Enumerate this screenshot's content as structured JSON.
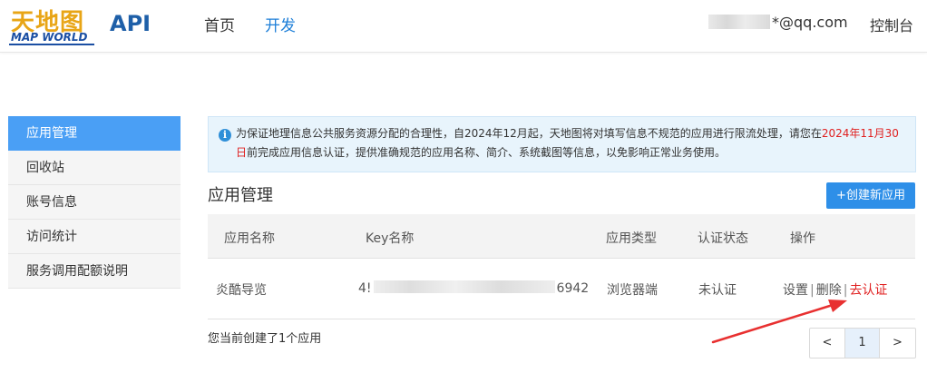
{
  "header": {
    "logo_cn": "天地图",
    "logo_en": "MAP WORLD",
    "api_label": "API",
    "nav": [
      {
        "label": "首页",
        "active": false
      },
      {
        "label": "开发",
        "active": true
      }
    ],
    "email_suffix": "*@qq.com",
    "console_label": "控制台"
  },
  "sidebar": {
    "items": [
      {
        "label": "应用管理",
        "active": true
      },
      {
        "label": "回收站",
        "active": false
      },
      {
        "label": "账号信息",
        "active": false
      },
      {
        "label": "访问统计",
        "active": false
      },
      {
        "label": "服务调用配额说明",
        "active": false
      }
    ]
  },
  "notice": {
    "icon": "info-icon",
    "text_before": "为保证地理信息公共服务资源分配的合理性，自2024年12月起，天地图将对填写信息不规范的应用进行限流处理，请您在",
    "deadline": "2024年11月30日",
    "text_after": "前完成应用信息认证，提供准确规范的应用名称、简介、系统截图等信息，以免影响正常业务使用。"
  },
  "main": {
    "title": "应用管理",
    "create_button": "+创建新应用",
    "table": {
      "columns": [
        "应用名称",
        "Key名称",
        "应用类型",
        "认证状态",
        "操作"
      ],
      "rows": [
        {
          "name": "炎酷导览",
          "key_prefix": "4!",
          "key_suffix": "6942",
          "type": "浏览器端",
          "status": "未认证",
          "ops": {
            "settings": "设置",
            "delete": "删除",
            "verify": "去认证",
            "separator": "|"
          }
        }
      ]
    },
    "count_text": "您当前创建了1个应用",
    "pagination": {
      "prev": "<",
      "current": "1",
      "next": ">"
    }
  },
  "colors": {
    "accent": "#2e8fe8",
    "sidebar_active": "#4a9ff5",
    "warning_red": "#e02020",
    "notice_bg": "#e8f4fc"
  }
}
